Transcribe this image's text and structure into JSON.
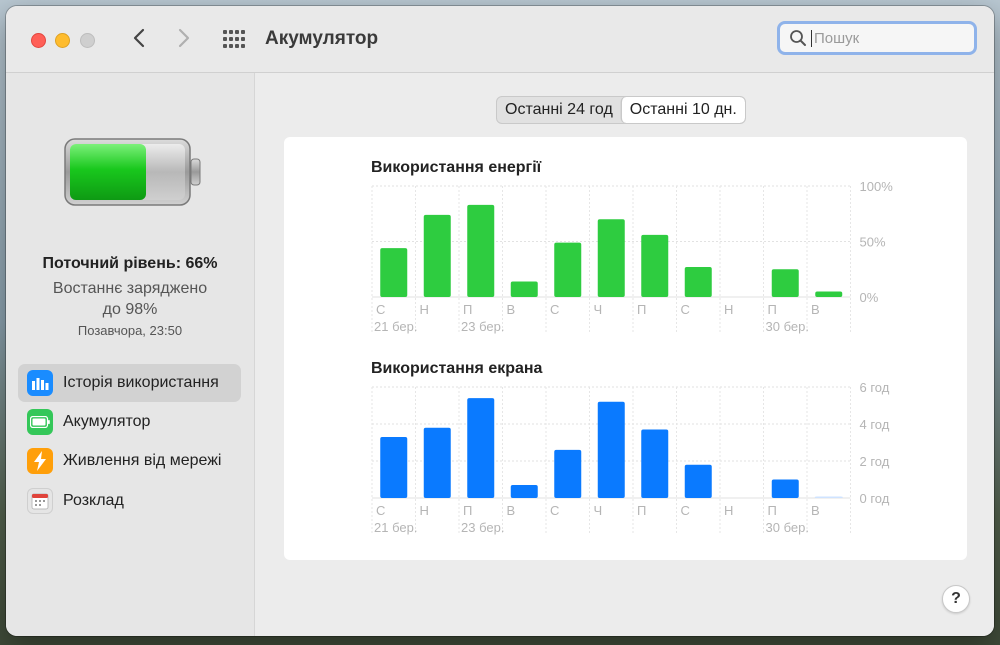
{
  "window": {
    "title": "Акумулятор"
  },
  "search": {
    "placeholder": "Пошук"
  },
  "sidebar": {
    "level": "Поточний рівень: 66%",
    "last_charged_line1": "Востаннє заряджено",
    "last_charged_line2": "до 98%",
    "last_charged_time": "Позавчора, 23:50",
    "battery_level": 0.66,
    "items": [
      {
        "label": "Історія використання",
        "icon": "bar-chart-icon",
        "color": "#1a8cff",
        "selected": true
      },
      {
        "label": "Акумулятор",
        "icon": "battery-icon",
        "color": "#34c759",
        "selected": false
      },
      {
        "label": "Живлення від мережі",
        "icon": "bolt-icon",
        "color": "#ff9f0a",
        "selected": false
      },
      {
        "label": "Розклад",
        "icon": "calendar-icon",
        "color": "#e5e5e5",
        "selected": false
      }
    ]
  },
  "segments": [
    {
      "label": "Останні 24 год",
      "selected": false
    },
    {
      "label": "Останні 10 дн.",
      "selected": true
    }
  ],
  "help": {
    "label": "?"
  },
  "chart_data": [
    {
      "type": "bar",
      "title": "Використання енергії",
      "categories": [
        "С",
        "Н",
        "П",
        "В",
        "С",
        "Ч",
        "П",
        "С",
        "Н",
        "П",
        "В"
      ],
      "dates": [
        {
          "index": 0,
          "label": "21 бер."
        },
        {
          "index": 2,
          "label": "23 бер."
        },
        {
          "index": 9,
          "label": "30 бер."
        }
      ],
      "values": [
        44,
        74,
        83,
        14,
        49,
        70,
        56,
        27,
        0,
        25,
        5
      ],
      "yticks": [
        "100%",
        "50%",
        "0%"
      ],
      "ylim": [
        0,
        100
      ],
      "color": "#2ecc40"
    },
    {
      "type": "bar",
      "title": "Використання екрана",
      "categories": [
        "С",
        "Н",
        "П",
        "В",
        "С",
        "Ч",
        "П",
        "С",
        "Н",
        "П",
        "В"
      ],
      "dates": [
        {
          "index": 0,
          "label": "21 бер."
        },
        {
          "index": 2,
          "label": "23 бер."
        },
        {
          "index": 9,
          "label": "30 бер."
        }
      ],
      "values": [
        3.3,
        3.8,
        5.4,
        0.7,
        2.6,
        5.2,
        3.7,
        1.8,
        0,
        1.0,
        0.05
      ],
      "yticks": [
        "6 год",
        "4 год",
        "2 год",
        "0 год"
      ],
      "ylim": [
        0,
        6
      ],
      "color": "#0a7aff"
    }
  ]
}
